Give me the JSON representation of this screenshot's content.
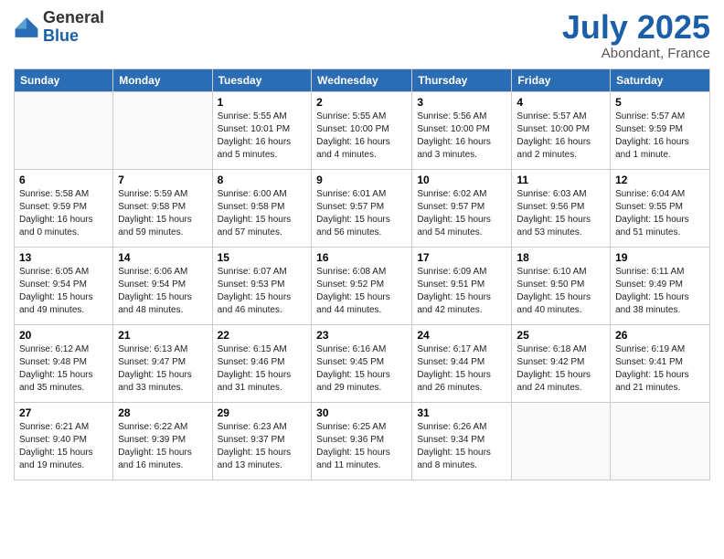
{
  "header": {
    "logo_general": "General",
    "logo_blue": "Blue",
    "month": "July 2025",
    "location": "Abondant, France"
  },
  "weekdays": [
    "Sunday",
    "Monday",
    "Tuesday",
    "Wednesday",
    "Thursday",
    "Friday",
    "Saturday"
  ],
  "weeks": [
    [
      {
        "day": "",
        "info": ""
      },
      {
        "day": "",
        "info": ""
      },
      {
        "day": "1",
        "info": "Sunrise: 5:55 AM\nSunset: 10:01 PM\nDaylight: 16 hours and 5 minutes."
      },
      {
        "day": "2",
        "info": "Sunrise: 5:55 AM\nSunset: 10:00 PM\nDaylight: 16 hours and 4 minutes."
      },
      {
        "day": "3",
        "info": "Sunrise: 5:56 AM\nSunset: 10:00 PM\nDaylight: 16 hours and 3 minutes."
      },
      {
        "day": "4",
        "info": "Sunrise: 5:57 AM\nSunset: 10:00 PM\nDaylight: 16 hours and 2 minutes."
      },
      {
        "day": "5",
        "info": "Sunrise: 5:57 AM\nSunset: 9:59 PM\nDaylight: 16 hours and 1 minute."
      }
    ],
    [
      {
        "day": "6",
        "info": "Sunrise: 5:58 AM\nSunset: 9:59 PM\nDaylight: 16 hours and 0 minutes."
      },
      {
        "day": "7",
        "info": "Sunrise: 5:59 AM\nSunset: 9:58 PM\nDaylight: 15 hours and 59 minutes."
      },
      {
        "day": "8",
        "info": "Sunrise: 6:00 AM\nSunset: 9:58 PM\nDaylight: 15 hours and 57 minutes."
      },
      {
        "day": "9",
        "info": "Sunrise: 6:01 AM\nSunset: 9:57 PM\nDaylight: 15 hours and 56 minutes."
      },
      {
        "day": "10",
        "info": "Sunrise: 6:02 AM\nSunset: 9:57 PM\nDaylight: 15 hours and 54 minutes."
      },
      {
        "day": "11",
        "info": "Sunrise: 6:03 AM\nSunset: 9:56 PM\nDaylight: 15 hours and 53 minutes."
      },
      {
        "day": "12",
        "info": "Sunrise: 6:04 AM\nSunset: 9:55 PM\nDaylight: 15 hours and 51 minutes."
      }
    ],
    [
      {
        "day": "13",
        "info": "Sunrise: 6:05 AM\nSunset: 9:54 PM\nDaylight: 15 hours and 49 minutes."
      },
      {
        "day": "14",
        "info": "Sunrise: 6:06 AM\nSunset: 9:54 PM\nDaylight: 15 hours and 48 minutes."
      },
      {
        "day": "15",
        "info": "Sunrise: 6:07 AM\nSunset: 9:53 PM\nDaylight: 15 hours and 46 minutes."
      },
      {
        "day": "16",
        "info": "Sunrise: 6:08 AM\nSunset: 9:52 PM\nDaylight: 15 hours and 44 minutes."
      },
      {
        "day": "17",
        "info": "Sunrise: 6:09 AM\nSunset: 9:51 PM\nDaylight: 15 hours and 42 minutes."
      },
      {
        "day": "18",
        "info": "Sunrise: 6:10 AM\nSunset: 9:50 PM\nDaylight: 15 hours and 40 minutes."
      },
      {
        "day": "19",
        "info": "Sunrise: 6:11 AM\nSunset: 9:49 PM\nDaylight: 15 hours and 38 minutes."
      }
    ],
    [
      {
        "day": "20",
        "info": "Sunrise: 6:12 AM\nSunset: 9:48 PM\nDaylight: 15 hours and 35 minutes."
      },
      {
        "day": "21",
        "info": "Sunrise: 6:13 AM\nSunset: 9:47 PM\nDaylight: 15 hours and 33 minutes."
      },
      {
        "day": "22",
        "info": "Sunrise: 6:15 AM\nSunset: 9:46 PM\nDaylight: 15 hours and 31 minutes."
      },
      {
        "day": "23",
        "info": "Sunrise: 6:16 AM\nSunset: 9:45 PM\nDaylight: 15 hours and 29 minutes."
      },
      {
        "day": "24",
        "info": "Sunrise: 6:17 AM\nSunset: 9:44 PM\nDaylight: 15 hours and 26 minutes."
      },
      {
        "day": "25",
        "info": "Sunrise: 6:18 AM\nSunset: 9:42 PM\nDaylight: 15 hours and 24 minutes."
      },
      {
        "day": "26",
        "info": "Sunrise: 6:19 AM\nSunset: 9:41 PM\nDaylight: 15 hours and 21 minutes."
      }
    ],
    [
      {
        "day": "27",
        "info": "Sunrise: 6:21 AM\nSunset: 9:40 PM\nDaylight: 15 hours and 19 minutes."
      },
      {
        "day": "28",
        "info": "Sunrise: 6:22 AM\nSunset: 9:39 PM\nDaylight: 15 hours and 16 minutes."
      },
      {
        "day": "29",
        "info": "Sunrise: 6:23 AM\nSunset: 9:37 PM\nDaylight: 15 hours and 13 minutes."
      },
      {
        "day": "30",
        "info": "Sunrise: 6:25 AM\nSunset: 9:36 PM\nDaylight: 15 hours and 11 minutes."
      },
      {
        "day": "31",
        "info": "Sunrise: 6:26 AM\nSunset: 9:34 PM\nDaylight: 15 hours and 8 minutes."
      },
      {
        "day": "",
        "info": ""
      },
      {
        "day": "",
        "info": ""
      }
    ]
  ]
}
